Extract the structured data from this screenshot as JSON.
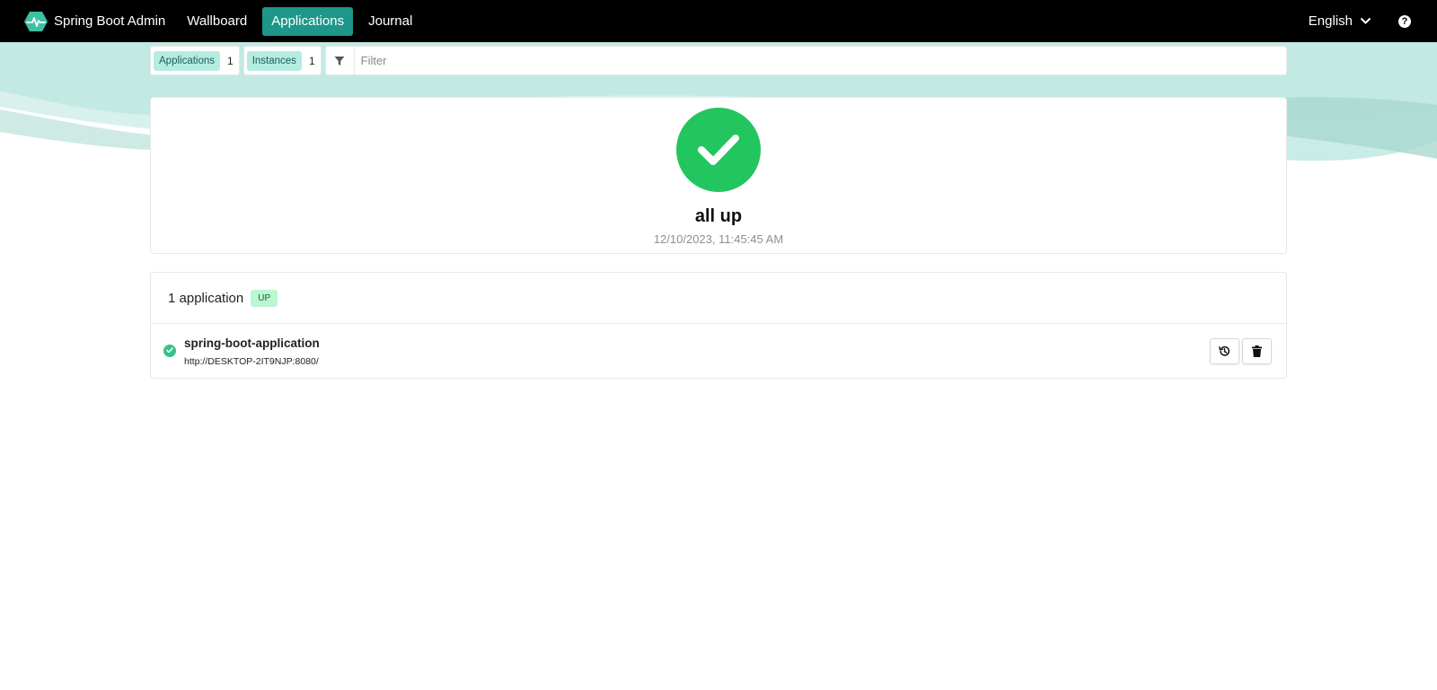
{
  "nav": {
    "brand": "Spring Boot Admin",
    "links": [
      "Wallboard",
      "Applications",
      "Journal"
    ],
    "active": "Applications",
    "language": "English",
    "help_icon": "question-circle-icon"
  },
  "filterbar": {
    "applications_label": "Applications",
    "applications_count": "1",
    "instances_label": "Instances",
    "instances_count": "1",
    "filter_placeholder": "Filter",
    "filter_value": ""
  },
  "status": {
    "title": "all up",
    "timestamp": "12/10/2023, 11:45:45 AM",
    "icon": "check-icon"
  },
  "applications": {
    "heading": "1 application",
    "badge": "UP",
    "items": [
      {
        "name": "spring-boot-application",
        "url": "http://DESKTOP-2IT9NJP:8080/",
        "status_icon": "check-circle-icon",
        "actions": [
          "history-icon",
          "trash-icon"
        ]
      }
    ]
  },
  "colors": {
    "navbar": "#000000",
    "active_tab": "#1f968a",
    "status_up": "#22c55e",
    "tag_bg": "#b5ece2",
    "badge_bg": "#bbf7d0"
  }
}
